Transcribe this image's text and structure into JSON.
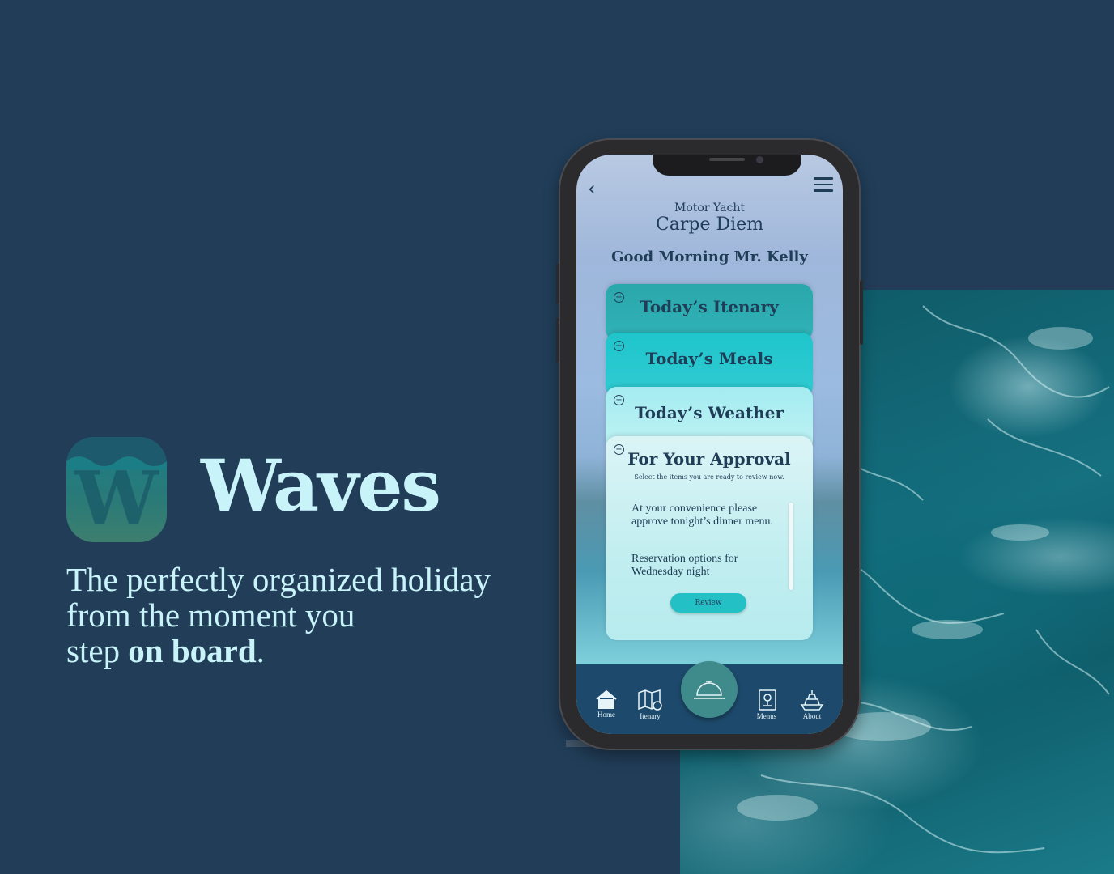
{
  "brand": {
    "icon_letter": "W",
    "title": "Waves",
    "tagline_line1": "The perfectly organized holiday",
    "tagline_line2": "from the moment you",
    "tagline_line3_prefix": "step ",
    "tagline_line3_bold": "on board",
    "tagline_line3_suffix": "."
  },
  "app": {
    "yacht_type": "Motor Yacht",
    "yacht_name": "Carpe Diem",
    "greeting": "Good Morning Mr. Kelly",
    "cards": [
      {
        "title": "Today’s Itenary"
      },
      {
        "title": "Today’s Meals"
      },
      {
        "title": "Today’s Weather"
      },
      {
        "title": "For Your Approval",
        "subtitle": "Select the items you are ready to review now."
      }
    ],
    "approval_items": [
      "At your convenience please approve tonight’s dinner menu.",
      "Reservation options for Wednesday night"
    ],
    "review_button": "Review",
    "nav": [
      {
        "label": "Home",
        "icon": "home-icon"
      },
      {
        "label": "Itenary",
        "icon": "map-icon"
      },
      {
        "label": "",
        "icon": "service-bell-icon"
      },
      {
        "label": "Menus",
        "icon": "menu-book-icon"
      },
      {
        "label": "About",
        "icon": "yacht-icon"
      }
    ]
  },
  "colors": {
    "background": "#213d58",
    "accent_text": "#c8f3f9",
    "navbar": "#1d4a6c",
    "review_button": "#23c0c6"
  }
}
